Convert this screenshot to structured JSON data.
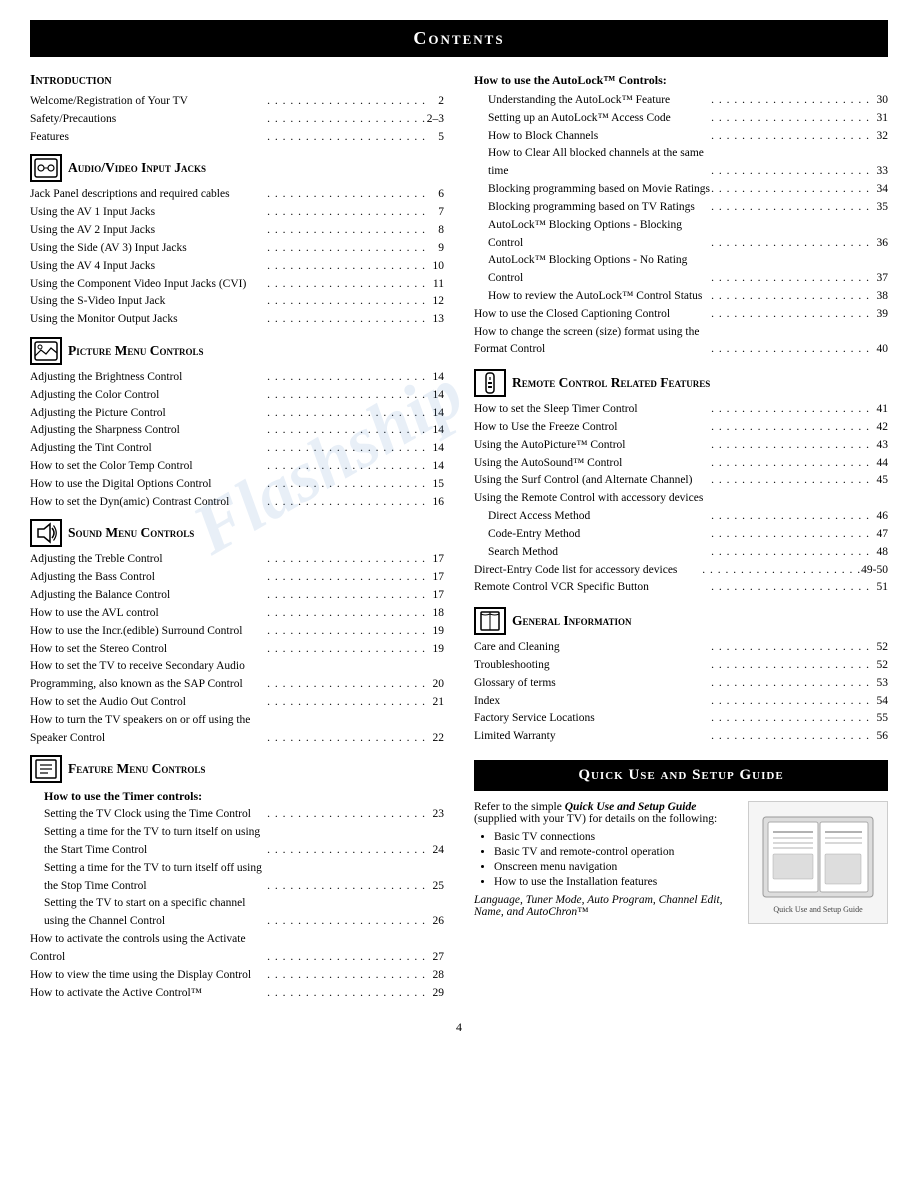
{
  "title": "Contents",
  "left_column": {
    "intro": {
      "header": "Introduction",
      "entries": [
        {
          "label": "Welcome/Registration of Your TV",
          "dots": true,
          "page": "2"
        },
        {
          "label": "Safety/Precautions",
          "dots": true,
          "page": "2–3"
        },
        {
          "label": "Features",
          "dots": true,
          "page": "5"
        }
      ]
    },
    "av_input": {
      "header": "Audio/Video Input Jacks",
      "icon": "av",
      "entries": [
        {
          "label": "Jack Panel descriptions and required cables",
          "dots": true,
          "page": "6"
        },
        {
          "label": "Using the AV 1 Input Jacks",
          "dots": true,
          "page": "7"
        },
        {
          "label": "Using the AV 2 Input Jacks",
          "dots": true,
          "page": "8"
        },
        {
          "label": "Using the Side (AV 3) Input Jacks",
          "dots": true,
          "page": "9"
        },
        {
          "label": "Using the AV 4 Input Jacks",
          "dots": true,
          "page": "10"
        },
        {
          "label": "Using the Component Video Input Jacks (CVI)",
          "dots": true,
          "page": "11"
        },
        {
          "label": "Using the S-Video Input Jack",
          "dots": true,
          "page": "12"
        },
        {
          "label": "Using the Monitor Output Jacks",
          "dots": true,
          "page": "13"
        }
      ]
    },
    "picture_menu": {
      "header": "Picture Menu Controls",
      "icon": "picture",
      "entries": [
        {
          "label": "Adjusting the Brightness Control",
          "dots": true,
          "page": "14"
        },
        {
          "label": "Adjusting the Color Control",
          "dots": true,
          "page": "14"
        },
        {
          "label": "Adjusting the Picture Control",
          "dots": true,
          "page": "14"
        },
        {
          "label": "Adjusting the Sharpness Control",
          "dots": true,
          "page": "14"
        },
        {
          "label": "Adjusting the Tint Control",
          "dots": true,
          "page": "14"
        },
        {
          "label": "How to set the Color Temp Control",
          "dots": true,
          "page": "14"
        },
        {
          "label": "How to use the Digital Options Control",
          "dots": true,
          "page": "15"
        },
        {
          "label": "How to set the Dyn(amic) Contrast Control",
          "dots": true,
          "page": "16"
        }
      ]
    },
    "sound_menu": {
      "header": "Sound Menu Controls",
      "icon": "sound",
      "entries": [
        {
          "label": "Adjusting the Treble Control",
          "dots": true,
          "page": "17"
        },
        {
          "label": "Adjusting the Bass Control",
          "dots": true,
          "page": "17"
        },
        {
          "label": "Adjusting the Balance Control",
          "dots": true,
          "page": "17"
        },
        {
          "label": "How to use the AVL control",
          "dots": true,
          "page": "18"
        },
        {
          "label": "How to use the Incr.(edible) Surround Control",
          "dots": true,
          "page": "19"
        },
        {
          "label": "How to set the Stereo Control",
          "dots": true,
          "page": "19"
        },
        {
          "label": "How to set the TV to receive Secondary Audio Programming, also known as the SAP Control",
          "dots": true,
          "page": "20"
        },
        {
          "label": "How to set the Audio Out Control",
          "dots": true,
          "page": "21"
        },
        {
          "label": "How to turn the TV speakers on or off using the Speaker Control",
          "dots": true,
          "page": "22"
        }
      ]
    },
    "feature_menu": {
      "header": "Feature Menu Controls",
      "icon": "feature",
      "sub_header": "How to use the Timer controls:",
      "entries": [
        {
          "label": "Setting the TV Clock using the Time Control",
          "dots": true,
          "page": "23",
          "indent": 1
        },
        {
          "label": "Setting a time for the TV to turn itself on using the Start Time Control",
          "dots": true,
          "page": "24",
          "indent": 1
        },
        {
          "label": "Setting a time for the TV to turn itself off using the Stop Time Control",
          "dots": true,
          "page": "25",
          "indent": 1
        },
        {
          "label": "Setting the TV to start on a specific channel using the Channel Control",
          "dots": true,
          "page": "26",
          "indent": 1
        },
        {
          "label": "How to activate the controls using the Activate Control",
          "dots": true,
          "page": "27"
        },
        {
          "label": "How to view the time using the Display Control",
          "dots": true,
          "page": "28"
        },
        {
          "label": "How to activate the Active Control™",
          "dots": true,
          "page": "29"
        }
      ]
    }
  },
  "right_column": {
    "autolock": {
      "sub_header": "How to use the AutoLock™ Controls:",
      "entries": [
        {
          "label": "Understanding the AutoLock™ Feature",
          "dots": true,
          "page": "30",
          "indent": 1
        },
        {
          "label": "Setting up an AutoLock™ Access Code",
          "dots": true,
          "page": "31",
          "indent": 1
        },
        {
          "label": "How to Block Channels",
          "dots": true,
          "page": "32",
          "indent": 1
        },
        {
          "label": "How to Clear All blocked channels at the same time",
          "dots": true,
          "page": "33",
          "indent": 1
        },
        {
          "label": "Blocking programming based on Movie Ratings",
          "dots": true,
          "page": "34",
          "indent": 1
        },
        {
          "label": "Blocking programming based on TV Ratings",
          "dots": true,
          "page": "35",
          "indent": 1
        },
        {
          "label": "AutoLock™ Blocking Options - Blocking Control",
          "dots": true,
          "page": "36",
          "indent": 1
        },
        {
          "label": "AutoLock™ Blocking Options - No Rating Control",
          "dots": true,
          "page": "37",
          "indent": 1
        },
        {
          "label": "How to review the AutoLock™ Control Status",
          "dots": true,
          "page": "38",
          "indent": 1
        },
        {
          "label": "How to use the Closed Captioning Control",
          "dots": true,
          "page": "39"
        },
        {
          "label": "How to change the screen (size) format using the Format Control",
          "dots": true,
          "page": "40"
        }
      ]
    },
    "remote_control": {
      "header": "Remote Control Related Features",
      "icon": "remote",
      "entries": [
        {
          "label": "How to set the Sleep Timer Control",
          "dots": true,
          "page": "41"
        },
        {
          "label": "How to Use the Freeze Control",
          "dots": true,
          "page": "42"
        },
        {
          "label": "Using the AutoPicture™ Control",
          "dots": true,
          "page": "43"
        },
        {
          "label": "Using the AutoSound™ Control",
          "dots": true,
          "page": "44"
        },
        {
          "label": "Using the Surf Control (and Alternate Channel)",
          "dots": true,
          "page": "45"
        },
        {
          "label": "Using the Remote Control with accessory devices",
          "dots": false,
          "page": ""
        },
        {
          "label": "Direct Access Method",
          "dots": true,
          "page": "46",
          "indent": 1
        },
        {
          "label": "Code-Entry Method",
          "dots": true,
          "page": "47",
          "indent": 1
        },
        {
          "label": "Search Method",
          "dots": true,
          "page": "48",
          "indent": 1
        },
        {
          "label": "Direct-Entry Code list for accessory devices",
          "dots": true,
          "page": "49-50"
        },
        {
          "label": "Remote Control VCR Specific Button",
          "dots": true,
          "page": "51"
        }
      ]
    },
    "general_info": {
      "header": "General Information",
      "icon": "book",
      "entries": [
        {
          "label": "Care and Cleaning",
          "dots": true,
          "page": "52"
        },
        {
          "label": "Troubleshooting",
          "dots": true,
          "page": "52"
        },
        {
          "label": "Glossary of terms",
          "dots": true,
          "page": "53"
        },
        {
          "label": "Index",
          "dots": true,
          "page": "54"
        },
        {
          "label": "Factory Service Locations",
          "dots": true,
          "page": "55"
        },
        {
          "label": "Limited Warranty",
          "dots": true,
          "page": "56"
        }
      ]
    },
    "quick_use": {
      "bar_title": "Quick Use and Setup Guide",
      "intro_text": "Refer to the simple ",
      "intro_bold": "Quick Use and Setup Guide",
      "intro_rest": " (supplied with your TV) for details on the following:",
      "bullets": [
        "Basic TV connections",
        "Basic TV and remote-control operation",
        "Onscreen menu navigation",
        "How to use the Installation features"
      ],
      "italic_note": "Language, Tuner Mode, Auto Program, Channel Edit, Name, and AutoChron™"
    }
  },
  "page_number": "4",
  "watermark_text": "Flashship"
}
